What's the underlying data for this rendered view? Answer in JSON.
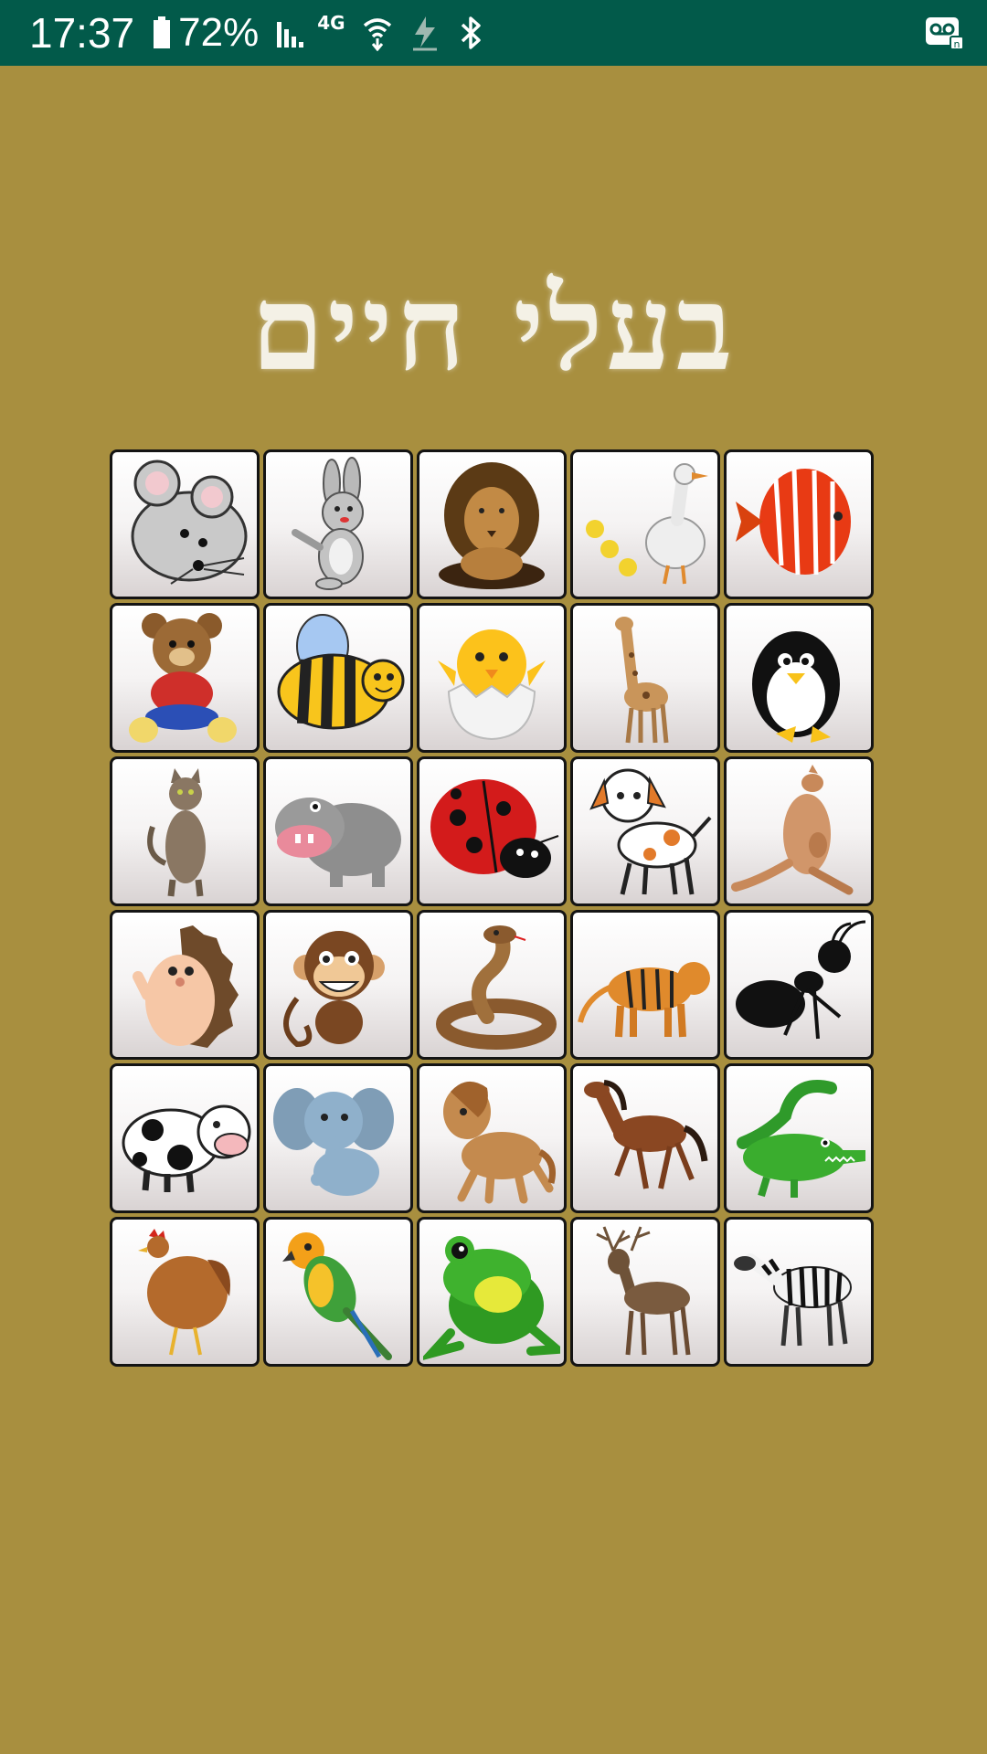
{
  "status_bar": {
    "time": "17:37",
    "battery": "72%",
    "network_label": "4G",
    "icons": [
      "battery-icon",
      "signal-icon",
      "wifi-icon",
      "download-icon",
      "bluetooth-icon",
      "voicemail-icon"
    ]
  },
  "title": "בעלי חיים",
  "colors": {
    "background": "#a88f3f",
    "status_bar": "#025a4a",
    "title": "#f4f1e6",
    "tile_border": "#141414"
  },
  "animals": [
    "mouse",
    "rabbit",
    "lion",
    "goose",
    "fish",
    "teddy-bear",
    "bee",
    "chick",
    "giraffe",
    "penguin",
    "cat",
    "hippo",
    "ladybug",
    "dog",
    "kangaroo",
    "hedgehog",
    "monkey",
    "snake",
    "tiger",
    "ant",
    "cow",
    "elephant",
    "horse-cartoon",
    "horse",
    "crocodile",
    "hen",
    "parrot",
    "frog",
    "deer",
    "zebra"
  ]
}
